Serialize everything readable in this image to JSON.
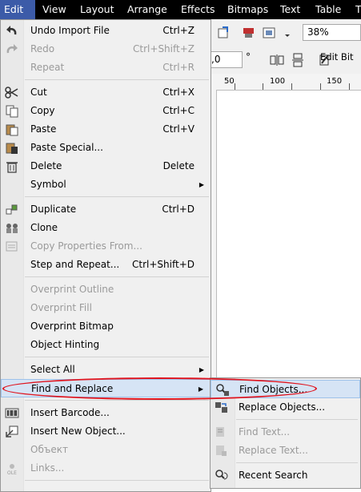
{
  "menubar": {
    "items": [
      {
        "label": "Edit"
      },
      {
        "label": "View"
      },
      {
        "label": "Layout"
      },
      {
        "label": "Arrange"
      },
      {
        "label": "Effects"
      },
      {
        "label": "Bitmaps"
      },
      {
        "label": "Text"
      },
      {
        "label": "Table"
      },
      {
        "label": "T"
      }
    ]
  },
  "toolbar": {
    "zoom_value": "38%",
    "angle_value": ",0",
    "degree_symbol": "°",
    "edit_bitmap_label": "Edit Bit"
  },
  "ruler": {
    "ticks": [
      "50",
      "100",
      "150"
    ]
  },
  "edit_menu": {
    "items": [
      {
        "label": "Undo Import File",
        "shortcut": "Ctrl+Z",
        "icon": "undo-icon"
      },
      {
        "label": "Redo",
        "shortcut": "Ctrl+Shift+Z",
        "icon": "redo-icon"
      },
      {
        "label": "Repeat",
        "shortcut": "Ctrl+R",
        "icon": "repeat-icon"
      },
      {
        "label": "Cut",
        "shortcut": "Ctrl+X",
        "icon": "scissors-icon"
      },
      {
        "label": "Copy",
        "shortcut": "Ctrl+C",
        "icon": "copy-icon"
      },
      {
        "label": "Paste",
        "shortcut": "Ctrl+V",
        "icon": "paste-icon"
      },
      {
        "label": "Paste Special...",
        "shortcut": "",
        "icon": "paste-special-icon"
      },
      {
        "label": "Delete",
        "shortcut": "Delete",
        "icon": "trash-icon"
      },
      {
        "label": "Symbol",
        "shortcut": "",
        "icon": ""
      },
      {
        "label": "Duplicate",
        "shortcut": "Ctrl+D",
        "icon": "duplicate-icon"
      },
      {
        "label": "Clone",
        "shortcut": "",
        "icon": "clone-icon"
      },
      {
        "label": "Copy Properties From...",
        "shortcut": "",
        "icon": "copy-properties-icon"
      },
      {
        "label": "Step and Repeat...",
        "shortcut": "Ctrl+Shift+D",
        "icon": ""
      },
      {
        "label": "Overprint Outline",
        "shortcut": "",
        "icon": ""
      },
      {
        "label": "Overprint Fill",
        "shortcut": "",
        "icon": ""
      },
      {
        "label": "Overprint Bitmap",
        "shortcut": "",
        "icon": ""
      },
      {
        "label": "Object Hinting",
        "shortcut": "",
        "icon": ""
      },
      {
        "label": "Select All",
        "shortcut": "",
        "icon": ""
      },
      {
        "label": "Find and Replace",
        "shortcut": "",
        "icon": ""
      },
      {
        "label": "Insert Barcode...",
        "shortcut": "",
        "icon": "barcode-icon"
      },
      {
        "label": "Insert New Object...",
        "shortcut": "",
        "icon": "insert-object-icon"
      },
      {
        "label": "Объект",
        "shortcut": "",
        "icon": ""
      },
      {
        "label": "Links...",
        "shortcut": "",
        "icon": "ole-icon"
      }
    ]
  },
  "find_replace_submenu": {
    "items": [
      {
        "label": "Find Objects...",
        "icon": "find-objects-icon"
      },
      {
        "label": "Replace Objects...",
        "icon": "replace-objects-icon"
      },
      {
        "label": "Find Text...",
        "icon": "find-text-icon"
      },
      {
        "label": "Replace Text...",
        "icon": "replace-text-icon"
      },
      {
        "label": "Recent Search",
        "icon": "recent-search-icon"
      }
    ]
  },
  "colors": {
    "menubar_bg": "#000000",
    "active_menu_bg": "#3c5ba8",
    "highlight_bg": "#d6e4f5",
    "annotation_red": "#e0141e",
    "disabled_text": "#9a9a9a"
  }
}
